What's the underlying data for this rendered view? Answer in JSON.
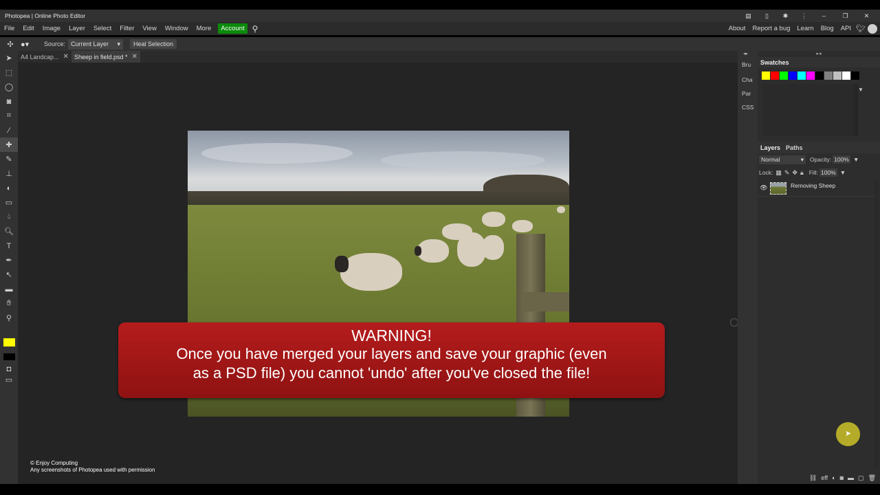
{
  "window": {
    "title": "Photopea | Online Photo Editor"
  },
  "menu": {
    "items": [
      "File",
      "Edit",
      "Image",
      "Layer",
      "Select",
      "Filter",
      "View",
      "Window",
      "More"
    ],
    "account": "Account",
    "right_links": [
      "About",
      "Report a bug",
      "Learn",
      "Blog",
      "API"
    ]
  },
  "options": {
    "source_label": "Source:",
    "source_value": "Current Layer",
    "heal_button": "Heal Selection"
  },
  "tabs": [
    {
      "label": "A4 Landcap..."
    },
    {
      "label": "Sheep in field.psd *"
    }
  ],
  "side_tabs": [
    "Bru",
    "Cha",
    "Par",
    "CSS"
  ],
  "swatches": {
    "title": "Swatches",
    "colors": [
      "#ffff00",
      "#ff0000",
      "#00ff00",
      "#0000ff",
      "#00ffff",
      "#ff00ff",
      "#000000",
      "#808080",
      "#c0c0c0",
      "#ffffff",
      "#000000"
    ]
  },
  "layers_panel": {
    "tabs": [
      "Layers",
      "Paths"
    ],
    "blend_mode": "Normal",
    "opacity_label": "Opacity:",
    "opacity_value": "100%",
    "lock_label": "Lock:",
    "fill_label": "Fill:",
    "fill_value": "100%",
    "layers": [
      {
        "name": "Removing Sheep",
        "visible": true
      }
    ]
  },
  "warning": {
    "title": "WARNING!",
    "line1": "Once you have merged your layers and save your graphic (even",
    "line2": "as a PSD file) you cannot 'undo' after you've closed the file!"
  },
  "credit": {
    "line1": "© Enjoy Computing",
    "line2": "Any screenshots of Photopea used with permission"
  },
  "colors": {
    "foreground": "#ffff00",
    "background": "#000000",
    "account_bg": "#0b8a0b",
    "warning_bg": "#a01818"
  }
}
